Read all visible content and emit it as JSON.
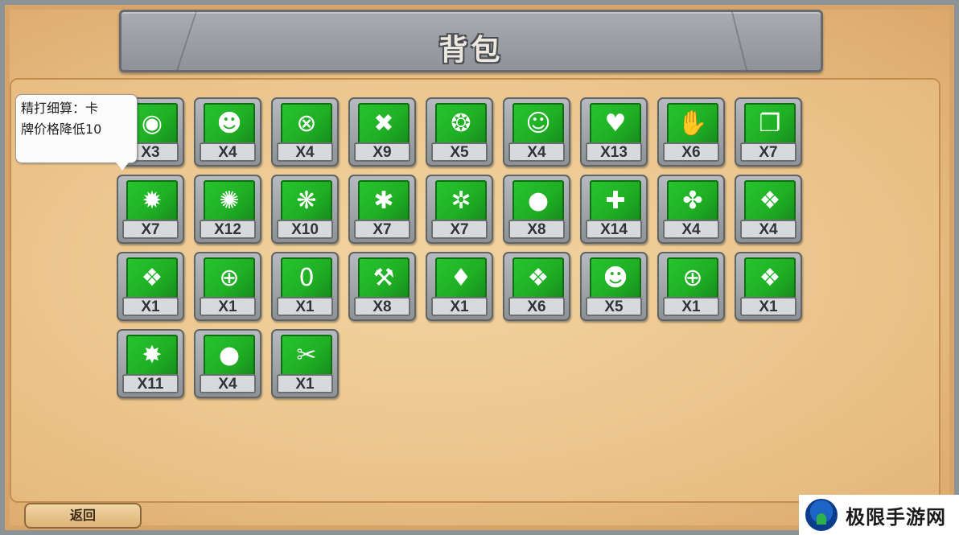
{
  "title": "背包",
  "tooltip": {
    "line1": "精打细算：卡",
    "line2": "牌价格降低10"
  },
  "back_label": "返回",
  "watermark": "极限手游网",
  "colors": {
    "card_green": "#1fae24",
    "stone": "#8f9398",
    "parchment": "#ebc58e"
  },
  "items": [
    {
      "count": "X3",
      "icon": "eye-swirl-icon",
      "glyph": "◉"
    },
    {
      "count": "X4",
      "icon": "face-plus-icon",
      "glyph": "☻"
    },
    {
      "count": "X4",
      "icon": "target-x-icon",
      "glyph": "⊗"
    },
    {
      "count": "X9",
      "icon": "crossed-x-icon",
      "glyph": "✖"
    },
    {
      "count": "X5",
      "icon": "dots-ring-icon",
      "glyph": "❂"
    },
    {
      "count": "X4",
      "icon": "face-ring-icon",
      "glyph": "☺"
    },
    {
      "count": "X13",
      "icon": "heart-face-icon",
      "glyph": "♥"
    },
    {
      "count": "X6",
      "icon": "hand-minus-icon",
      "glyph": "✋"
    },
    {
      "count": "X7",
      "icon": "cards-icon",
      "glyph": "❐"
    },
    {
      "count": "X7",
      "icon": "sun-minus-icon",
      "glyph": "✹"
    },
    {
      "count": "X12",
      "icon": "sun-plus-icon",
      "glyph": "✺"
    },
    {
      "count": "X10",
      "icon": "blob-sparkle-icon",
      "glyph": "❋"
    },
    {
      "count": "X7",
      "icon": "hedgehog-icon",
      "glyph": "✱"
    },
    {
      "count": "X7",
      "icon": "spiky-plus-icon",
      "glyph": "✲"
    },
    {
      "count": "X8",
      "icon": "apple-plus-icon",
      "glyph": "●"
    },
    {
      "count": "X14",
      "icon": "heart-plus-icon",
      "glyph": "✚"
    },
    {
      "count": "X4",
      "icon": "fan-icon",
      "glyph": "✤"
    },
    {
      "count": "X4",
      "icon": "jaws-icon",
      "glyph": "❖"
    },
    {
      "count": "X1",
      "icon": "jaws-ring-icon",
      "glyph": "❖"
    },
    {
      "count": "X1",
      "icon": "plus-ring-icon",
      "glyph": "⊕"
    },
    {
      "count": "X1",
      "icon": "zero-ring-icon",
      "glyph": "0"
    },
    {
      "count": "X8",
      "icon": "hammer-minus-icon",
      "glyph": "⚒"
    },
    {
      "count": "X1",
      "icon": "drop-ring-icon",
      "glyph": "♦"
    },
    {
      "count": "X6",
      "icon": "fang-drop-icon",
      "glyph": "❖"
    },
    {
      "count": "X5",
      "icon": "twin-faces-icon",
      "glyph": "☻"
    },
    {
      "count": "X1",
      "icon": "plus-steam-icon",
      "glyph": "⊕"
    },
    {
      "count": "X1",
      "icon": "jaws-lines-icon",
      "glyph": "❖"
    },
    {
      "count": "X11",
      "icon": "star-burst-icon",
      "glyph": "✸"
    },
    {
      "count": "X4",
      "icon": "bomb-plus-icon",
      "glyph": "●"
    },
    {
      "count": "X1",
      "icon": "tools-icon",
      "glyph": "✂"
    }
  ]
}
